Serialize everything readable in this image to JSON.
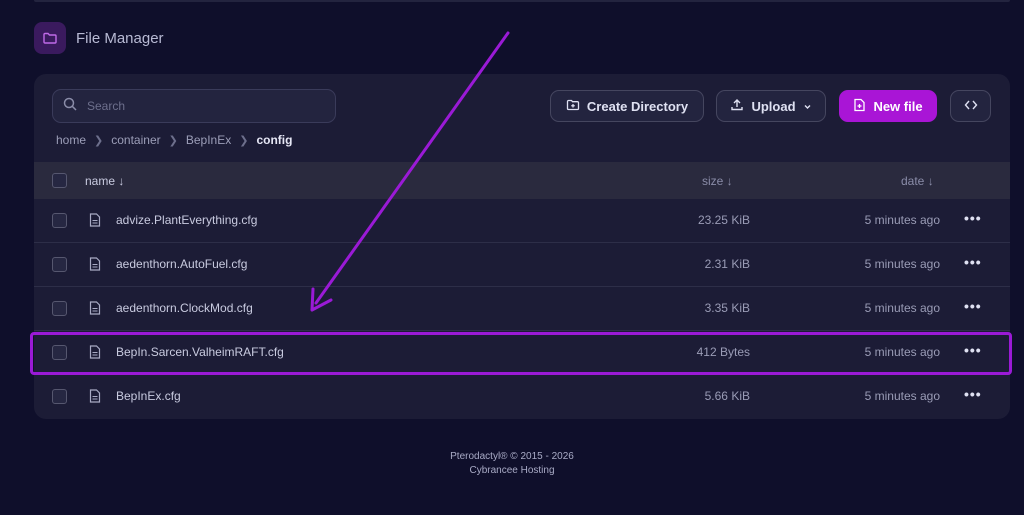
{
  "header": {
    "title": "File Manager",
    "icon": "folder-icon"
  },
  "search": {
    "placeholder": "Search"
  },
  "toolbar": {
    "create_directory": "Create Directory",
    "upload": "Upload",
    "new_file": "New file"
  },
  "breadcrumb": [
    "home",
    "container",
    "BepInEx",
    "config"
  ],
  "table": {
    "columns": {
      "name": "name ↓",
      "size": "size ↓",
      "date": "date ↓"
    },
    "rows": [
      {
        "name": "advize.PlantEverything.cfg",
        "size": "23.25 KiB",
        "date": "5 minutes ago"
      },
      {
        "name": "aedenthorn.AutoFuel.cfg",
        "size": "2.31 KiB",
        "date": "5 minutes ago"
      },
      {
        "name": "aedenthorn.ClockMod.cfg",
        "size": "3.35 KiB",
        "date": "5 minutes ago"
      },
      {
        "name": "BepIn.Sarcen.ValheimRAFT.cfg",
        "size": "412 Bytes",
        "date": "5 minutes ago"
      },
      {
        "name": "BepInEx.cfg",
        "size": "5.66 KiB",
        "date": "5 minutes ago"
      }
    ],
    "more_label": "•••"
  },
  "footer": {
    "line1": "Pterodactyl® © 2015 - 2026",
    "line2": "Cybrancee Hosting"
  },
  "colors": {
    "accent": "#a915d6",
    "background": "#0f0f2b",
    "panel": "#1c1c36"
  }
}
